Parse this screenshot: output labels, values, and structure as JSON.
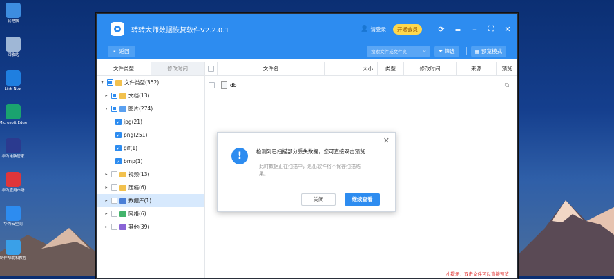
{
  "desktop_icons": [
    {
      "label": "此电脑",
      "color": "#3d8de0"
    },
    {
      "label": "回收站",
      "color": "#9fb7d6"
    },
    {
      "label": "Link Now",
      "color": "#1f7fe0"
    },
    {
      "label": "Microsoft Edge",
      "color": "#1aa36f"
    },
    {
      "label": "华为电脑管家",
      "color": "#2b3a8f"
    },
    {
      "label": "华为应用市场",
      "color": "#e0363a"
    },
    {
      "label": "华为云空间",
      "color": "#2d8cf0"
    },
    {
      "label": "制作帮助和教程",
      "color": "#3aa0e8"
    }
  ],
  "window": {
    "title": "转转大师数据恢复软件V2.2.0.1",
    "login": "请登录",
    "vip": "开通会员"
  },
  "toolbar": {
    "back": "返回",
    "search_placeholder": "搜索文件或文件夹",
    "filter": "筛选",
    "preview_mode": "预览模式"
  },
  "sidebar": {
    "tab_type": "文件类型",
    "tab_time": "修改时间",
    "tree": [
      {
        "label": "文件类型(352)",
        "level": 0,
        "arrow": "▾",
        "check": "part",
        "icon": "#f2c14e"
      },
      {
        "label": "文档(13)",
        "level": 1,
        "arrow": "▸",
        "check": "part",
        "icon": "#f2c14e"
      },
      {
        "label": "图片(274)",
        "level": 1,
        "arrow": "▾",
        "check": "part",
        "icon": "#5aa0f0"
      },
      {
        "label": "jpg(21)",
        "level": 2,
        "arrow": "",
        "check": "on",
        "icon": ""
      },
      {
        "label": "png(251)",
        "level": 2,
        "arrow": "",
        "check": "on",
        "icon": ""
      },
      {
        "label": "gif(1)",
        "level": 2,
        "arrow": "",
        "check": "on",
        "icon": ""
      },
      {
        "label": "bmp(1)",
        "level": 2,
        "arrow": "",
        "check": "on",
        "icon": ""
      },
      {
        "label": "视频(13)",
        "level": 1,
        "arrow": "▸",
        "check": "off",
        "icon": "#f2c14e"
      },
      {
        "label": "压缩(6)",
        "level": 1,
        "arrow": "▸",
        "check": "off",
        "icon": "#f2c14e"
      },
      {
        "label": "数据库(1)",
        "level": 1,
        "arrow": "▸",
        "check": "off",
        "icon": "#4a7fd6",
        "selected": true
      },
      {
        "label": "网络(6)",
        "level": 1,
        "arrow": "▸",
        "check": "off",
        "icon": "#43b36b"
      },
      {
        "label": "其他(39)",
        "level": 1,
        "arrow": "▸",
        "check": "off",
        "icon": "#8a64d6"
      }
    ]
  },
  "table": {
    "headers": [
      "文件名",
      "大小",
      "类型",
      "修改时间",
      "来源",
      "预览"
    ],
    "rows": [
      {
        "name": "db"
      }
    ]
  },
  "hint": "小提示：双击文件可以直接预览",
  "dialog": {
    "message": "检测到已扫描部分丢失数据，您可直接双击预览",
    "sub": "此时数据正在扫描中，退出软件将不保存扫描结果。",
    "close": "关闭",
    "continue": "继续查看"
  }
}
